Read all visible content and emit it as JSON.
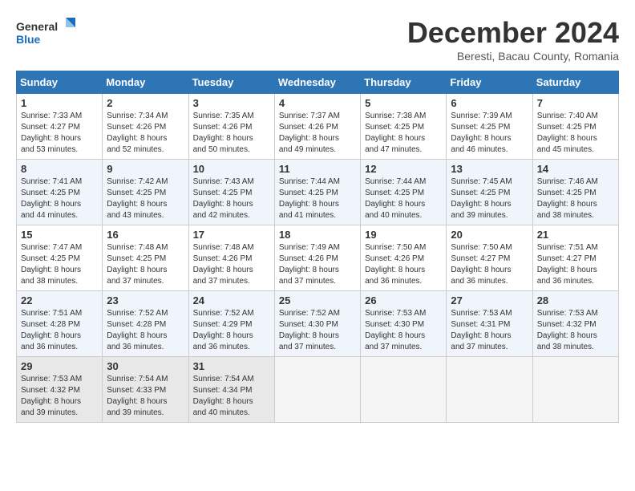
{
  "logo": {
    "line1": "General",
    "line2": "Blue"
  },
  "title": "December 2024",
  "subtitle": "Beresti, Bacau County, Romania",
  "weekdays": [
    "Sunday",
    "Monday",
    "Tuesday",
    "Wednesday",
    "Thursday",
    "Friday",
    "Saturday"
  ],
  "weeks": [
    [
      {
        "day": "1",
        "sunrise": "7:33 AM",
        "sunset": "4:27 PM",
        "daylight": "8 hours and 53 minutes."
      },
      {
        "day": "2",
        "sunrise": "7:34 AM",
        "sunset": "4:26 PM",
        "daylight": "8 hours and 52 minutes."
      },
      {
        "day": "3",
        "sunrise": "7:35 AM",
        "sunset": "4:26 PM",
        "daylight": "8 hours and 50 minutes."
      },
      {
        "day": "4",
        "sunrise": "7:37 AM",
        "sunset": "4:26 PM",
        "daylight": "8 hours and 49 minutes."
      },
      {
        "day": "5",
        "sunrise": "7:38 AM",
        "sunset": "4:25 PM",
        "daylight": "8 hours and 47 minutes."
      },
      {
        "day": "6",
        "sunrise": "7:39 AM",
        "sunset": "4:25 PM",
        "daylight": "8 hours and 46 minutes."
      },
      {
        "day": "7",
        "sunrise": "7:40 AM",
        "sunset": "4:25 PM",
        "daylight": "8 hours and 45 minutes."
      }
    ],
    [
      {
        "day": "8",
        "sunrise": "7:41 AM",
        "sunset": "4:25 PM",
        "daylight": "8 hours and 44 minutes."
      },
      {
        "day": "9",
        "sunrise": "7:42 AM",
        "sunset": "4:25 PM",
        "daylight": "8 hours and 43 minutes."
      },
      {
        "day": "10",
        "sunrise": "7:43 AM",
        "sunset": "4:25 PM",
        "daylight": "8 hours and 42 minutes."
      },
      {
        "day": "11",
        "sunrise": "7:44 AM",
        "sunset": "4:25 PM",
        "daylight": "8 hours and 41 minutes."
      },
      {
        "day": "12",
        "sunrise": "7:44 AM",
        "sunset": "4:25 PM",
        "daylight": "8 hours and 40 minutes."
      },
      {
        "day": "13",
        "sunrise": "7:45 AM",
        "sunset": "4:25 PM",
        "daylight": "8 hours and 39 minutes."
      },
      {
        "day": "14",
        "sunrise": "7:46 AM",
        "sunset": "4:25 PM",
        "daylight": "8 hours and 38 minutes."
      }
    ],
    [
      {
        "day": "15",
        "sunrise": "7:47 AM",
        "sunset": "4:25 PM",
        "daylight": "8 hours and 38 minutes."
      },
      {
        "day": "16",
        "sunrise": "7:48 AM",
        "sunset": "4:25 PM",
        "daylight": "8 hours and 37 minutes."
      },
      {
        "day": "17",
        "sunrise": "7:48 AM",
        "sunset": "4:26 PM",
        "daylight": "8 hours and 37 minutes."
      },
      {
        "day": "18",
        "sunrise": "7:49 AM",
        "sunset": "4:26 PM",
        "daylight": "8 hours and 37 minutes."
      },
      {
        "day": "19",
        "sunrise": "7:50 AM",
        "sunset": "4:26 PM",
        "daylight": "8 hours and 36 minutes."
      },
      {
        "day": "20",
        "sunrise": "7:50 AM",
        "sunset": "4:27 PM",
        "daylight": "8 hours and 36 minutes."
      },
      {
        "day": "21",
        "sunrise": "7:51 AM",
        "sunset": "4:27 PM",
        "daylight": "8 hours and 36 minutes."
      }
    ],
    [
      {
        "day": "22",
        "sunrise": "7:51 AM",
        "sunset": "4:28 PM",
        "daylight": "8 hours and 36 minutes."
      },
      {
        "day": "23",
        "sunrise": "7:52 AM",
        "sunset": "4:28 PM",
        "daylight": "8 hours and 36 minutes."
      },
      {
        "day": "24",
        "sunrise": "7:52 AM",
        "sunset": "4:29 PM",
        "daylight": "8 hours and 36 minutes."
      },
      {
        "day": "25",
        "sunrise": "7:52 AM",
        "sunset": "4:30 PM",
        "daylight": "8 hours and 37 minutes."
      },
      {
        "day": "26",
        "sunrise": "7:53 AM",
        "sunset": "4:30 PM",
        "daylight": "8 hours and 37 minutes."
      },
      {
        "day": "27",
        "sunrise": "7:53 AM",
        "sunset": "4:31 PM",
        "daylight": "8 hours and 37 minutes."
      },
      {
        "day": "28",
        "sunrise": "7:53 AM",
        "sunset": "4:32 PM",
        "daylight": "8 hours and 38 minutes."
      }
    ],
    [
      {
        "day": "29",
        "sunrise": "7:53 AM",
        "sunset": "4:32 PM",
        "daylight": "8 hours and 39 minutes."
      },
      {
        "day": "30",
        "sunrise": "7:54 AM",
        "sunset": "4:33 PM",
        "daylight": "8 hours and 39 minutes."
      },
      {
        "day": "31",
        "sunrise": "7:54 AM",
        "sunset": "4:34 PM",
        "daylight": "8 hours and 40 minutes."
      },
      null,
      null,
      null,
      null
    ]
  ],
  "labels": {
    "sunrise": "Sunrise:",
    "sunset": "Sunset:",
    "daylight": "Daylight:"
  }
}
